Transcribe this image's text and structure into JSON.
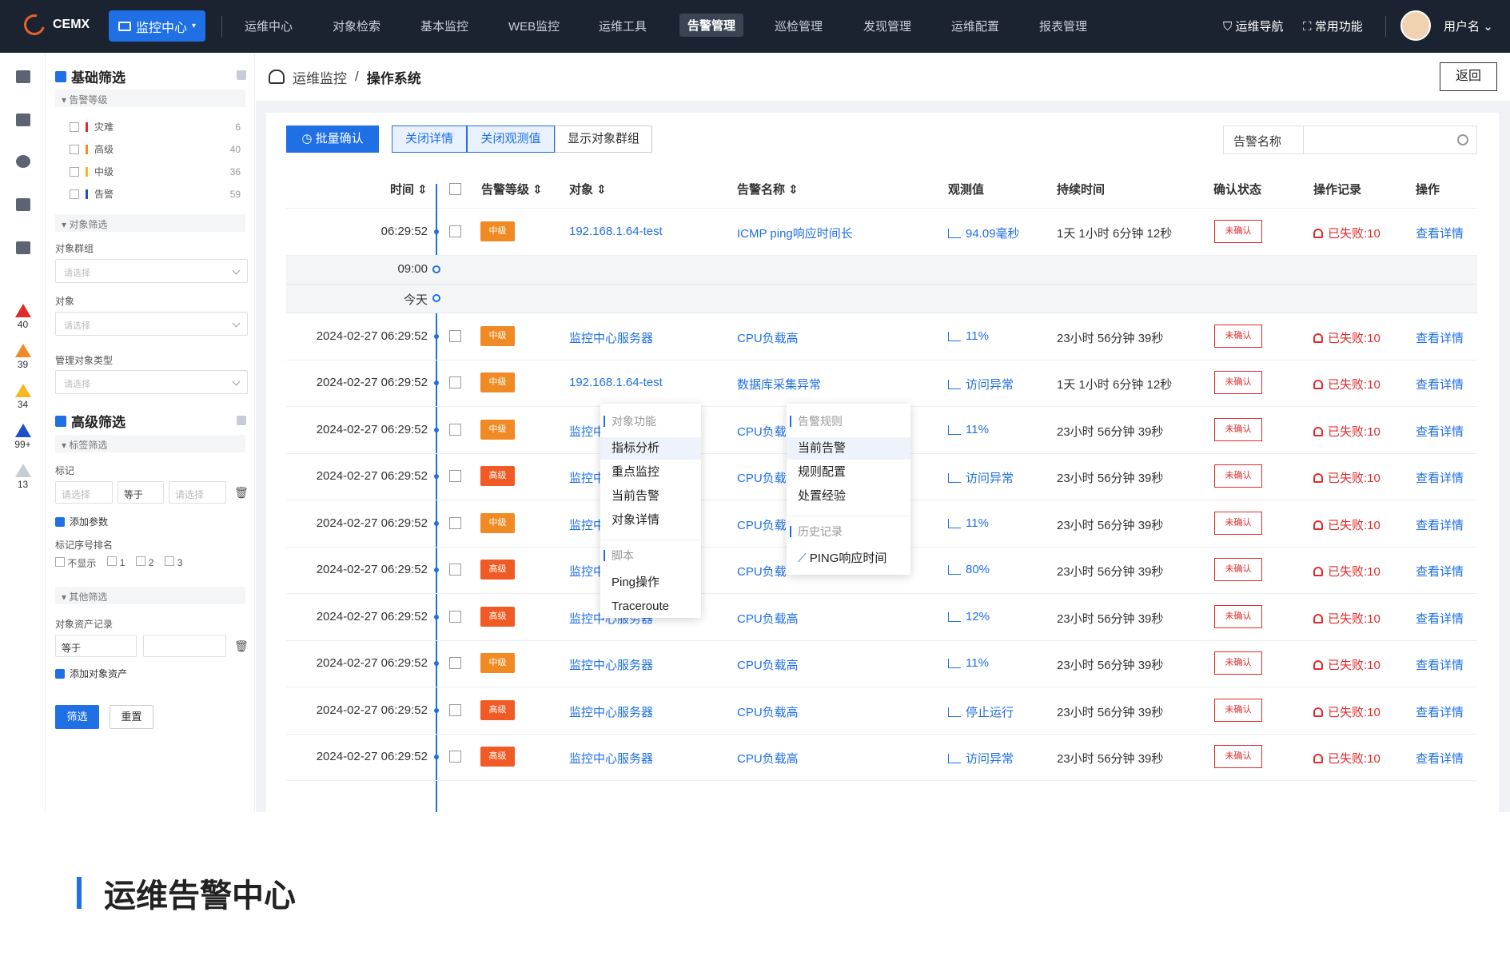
{
  "header": {
    "brand": "CEMX",
    "monitor_button": "监控中心",
    "nav": [
      "运维中心",
      "对象检索",
      "基本监控",
      "WEB监控",
      "运维工具",
      "告警管理",
      "巡检管理",
      "发现管理",
      "运维配置",
      "报表管理"
    ],
    "active_nav": "告警管理",
    "ops_nav": "运维导航",
    "common_func": "常用功能",
    "username": "用户名"
  },
  "iconbar": {
    "alerts": [
      {
        "count": "40",
        "color": "#e02b2b"
      },
      {
        "count": "39",
        "color": "#f08a24"
      },
      {
        "count": "34",
        "color": "#f5b820"
      },
      {
        "count": "99+",
        "color": "#1f4fc9"
      },
      {
        "count": "13",
        "color": "#c8ccd4"
      }
    ]
  },
  "filters": {
    "basic_title": "基础筛选",
    "alert_level_title": "告警等级",
    "levels": [
      {
        "label": "灾难",
        "count": "6",
        "color": "#e02b2b"
      },
      {
        "label": "高级",
        "count": "40",
        "color": "#f08a24"
      },
      {
        "label": "中级",
        "count": "36",
        "color": "#f5b820"
      },
      {
        "label": "告警",
        "count": "59",
        "color": "#1f4fc9"
      }
    ],
    "object_filter_title": "对象筛选",
    "object_group_label": "对象群组",
    "object_label": "对象",
    "manage_type_label": "管理对象类型",
    "placeholder": "请选择",
    "advanced_title": "高级筛选",
    "tag_filter_title": "标签筛选",
    "tag_label": "标记",
    "equals": "等于",
    "add_param": "添加参数",
    "tag_rank_label": "标记序号排名",
    "rank_options": [
      "不显示",
      "1",
      "2",
      "3"
    ],
    "other_filter_title": "其他筛选",
    "asset_record_label": "对象资产记录",
    "add_asset": "添加对象资产",
    "filter_button": "筛选",
    "reset_button": "重置"
  },
  "breadcrumb": {
    "parent": "运维监控",
    "separator": "/",
    "current": "操作系统",
    "back": "返回"
  },
  "toolbar": {
    "batch_confirm": "批量确认",
    "close_detail": "关闭详情",
    "close_obs": "关闭观测值",
    "show_group": "显示对象群组",
    "search_field": "告警名称"
  },
  "table": {
    "headers": [
      "时间",
      "告警等级",
      "对象",
      "告警名称",
      "观测值",
      "持续时间",
      "确认状态",
      "操作记录",
      "操作"
    ],
    "sep_labels": [
      "09:00",
      "今天"
    ],
    "rows": [
      {
        "time": "06:29:52",
        "level": "中级",
        "object": "192.168.1.64-test",
        "alert": "ICMP ping响应时间长",
        "obs": "94.09毫秒",
        "duration": "1天 1小时 6分钟 12秒",
        "status": "未确认",
        "record": "已失败:10",
        "action": "查看详情"
      },
      {
        "time": "2024-02-27 06:29:52",
        "level": "中级",
        "object": "监控中心服务器",
        "alert": "CPU负载高",
        "obs": "11%",
        "duration": "23小时 56分钟 39秒",
        "status": "未确认",
        "record": "已失败:10",
        "action": "查看详情"
      },
      {
        "time": "2024-02-27 06:29:52",
        "level": "中级",
        "object": "192.168.1.64-test",
        "alert": "数据库采集异常",
        "obs": "访问异常",
        "duration": "1天 1小时 6分钟 12秒",
        "status": "未确认",
        "record": "已失败:10",
        "action": "查看详情"
      },
      {
        "time": "2024-02-27 06:29:52",
        "level": "中级",
        "object": "监控中",
        "alert": "CPU负载",
        "obs": "11%",
        "duration": "23小时 56分钟 39秒",
        "status": "未确认",
        "record": "已失败:10",
        "action": "查看详情"
      },
      {
        "time": "2024-02-27 06:29:52",
        "level": "高级",
        "object": "监控中",
        "alert": "CPU负载",
        "obs": "访问异常",
        "duration": "23小时 56分钟 39秒",
        "status": "未确认",
        "record": "已失败:10",
        "action": "查看详情"
      },
      {
        "time": "2024-02-27 06:29:52",
        "level": "中级",
        "object": "监控中",
        "alert": "CPU负载",
        "obs": "11%",
        "duration": "23小时 56分钟 39秒",
        "status": "未确认",
        "record": "已失败:10",
        "action": "查看详情"
      },
      {
        "time": "2024-02-27 06:29:52",
        "level": "高级",
        "object": "监控中",
        "alert": "CPU负载",
        "obs": "80%",
        "duration": "23小时 56分钟 39秒",
        "status": "未确认",
        "record": "已失败:10",
        "action": "查看详情"
      },
      {
        "time": "2024-02-27 06:29:52",
        "level": "高级",
        "object": "监控中心服务器",
        "alert": "CPU负载高",
        "obs": "12%",
        "duration": "23小时 56分钟 39秒",
        "status": "未确认",
        "record": "已失败:10",
        "action": "查看详情"
      },
      {
        "time": "2024-02-27 06:29:52",
        "level": "中级",
        "object": "监控中心服务器",
        "alert": "CPU负载高",
        "obs": "11%",
        "duration": "23小时 56分钟 39秒",
        "status": "未确认",
        "record": "已失败:10",
        "action": "查看详情"
      },
      {
        "time": "2024-02-27 06:29:52",
        "level": "高级",
        "object": "监控中心服务器",
        "alert": "CPU负载高",
        "obs": "停止运行",
        "duration": "23小时 56分钟 39秒",
        "status": "未确认",
        "record": "已失败:10",
        "action": "查看详情"
      },
      {
        "time": "2024-02-27 06:29:52",
        "level": "高级",
        "object": "监控中心服务器",
        "alert": "CPU负载高",
        "obs": "访问异常",
        "duration": "23小时 56分钟 39秒",
        "status": "未确认",
        "record": "已失败:10",
        "action": "查看详情"
      }
    ]
  },
  "context_menu_object": {
    "heading": "对象功能",
    "items": [
      "指标分析",
      "重点监控",
      "当前告警",
      "对象详情"
    ],
    "script_heading": "脚本",
    "script_items": [
      "Ping操作",
      "Traceroute"
    ]
  },
  "context_menu_alert": {
    "heading": "告警规则",
    "items": [
      "当前告警",
      "规则配置",
      "处置经验"
    ],
    "history_heading": "历史记录",
    "history_items": [
      "PING响应时间"
    ]
  },
  "footer": {
    "title": "运维告警中心"
  },
  "colors": {
    "primary": "#1f6fe5",
    "mid_level": "#f08a24",
    "high_level": "#f05a24",
    "danger": "#e02b2b",
    "topbar": "#1b2230"
  }
}
